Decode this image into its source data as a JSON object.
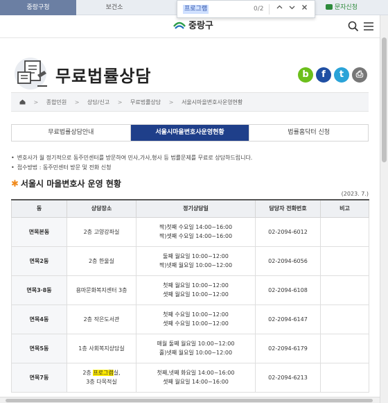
{
  "top_tabs": [
    "중랑구청",
    "보건소"
  ],
  "sms_label": "문자신청",
  "find": {
    "query": "프로그램",
    "count": "0/2"
  },
  "logo_text": "중랑구",
  "page_title": "무료법률상담",
  "social": [
    {
      "name": "blog-icon",
      "glyph": "b",
      "color": "#6cbf1b"
    },
    {
      "name": "facebook-icon",
      "glyph": "f",
      "color": "#1f4fa3"
    },
    {
      "name": "twitter-icon",
      "glyph": "t",
      "color": "#2aa3d8"
    },
    {
      "name": "print-icon",
      "glyph": "⎙",
      "color": "#777777"
    }
  ],
  "breadcrumbs": [
    "종합민원",
    "상담/신고",
    "무료법률상담",
    "서울시마을변호사운영현황"
  ],
  "tabs": [
    {
      "label": "무료법률상담안내",
      "active": false
    },
    {
      "label": "서울시마을변호사운영현황",
      "active": true
    },
    {
      "label": "법률홈닥터 신청",
      "active": false
    }
  ],
  "bullets": [
    "변호사가 월 정기적으로 동주민센터를 방문하여 민사,가사,형사 등 법률문제를 무료로 상담하드립니다.",
    "접수방법 : 동주민센터 방문 및 전화 신청"
  ],
  "section_title": "서울시 마을변호사 운영 현황",
  "date": "(2023. 7.)",
  "table": {
    "headers": [
      "동",
      "상담장소",
      "정기상담일",
      "담당자 전화번호",
      "비고"
    ],
    "rows": [
      {
        "dong": "면목본동",
        "place": [
          "2층 고양강좌실"
        ],
        "days": [
          "짝)첫째 수요일 14:00~16:00",
          "짝)셋째 수요일 14:00~16:00"
        ],
        "phone": "02-2094-6012"
      },
      {
        "dong": "면목2동",
        "place": [
          "2층 한울실"
        ],
        "days": [
          "둘째 월요일 10:00~12:00",
          "짝)넷째 월요일 10:00~12:00"
        ],
        "phone": "02-2094-6056"
      },
      {
        "dong": "면목3·8동",
        "place": [
          "용마문화복지센터 3층"
        ],
        "days": [
          "첫째 월요일 10:00~12:00",
          "셋째 월요일 10:00~12:00"
        ],
        "phone": "02-2094-6108"
      },
      {
        "dong": "면목4동",
        "place": [
          "2층 작은도서관"
        ],
        "days": [
          "첫째 수요일 10:00~12:00",
          "셋째 수요일 10:00~12:00"
        ],
        "phone": "02-2094-6147"
      },
      {
        "dong": "면목5동",
        "place": [
          "1층 사회복지상담실"
        ],
        "days": [
          "매월 둘째 월요일 10:00~12:00",
          "홀)넷째 월요일 10:00~12:00"
        ],
        "phone": "02-2094-6179"
      },
      {
        "dong": "면목7동",
        "place": [
          "2층 프로그램실,",
          "3층 다목적실"
        ],
        "days": [
          "첫째,넷째 화요일 14:00~16:00",
          "셋째 월요일 14:00~16:00"
        ],
        "phone": "02-2094-6213"
      }
    ]
  }
}
